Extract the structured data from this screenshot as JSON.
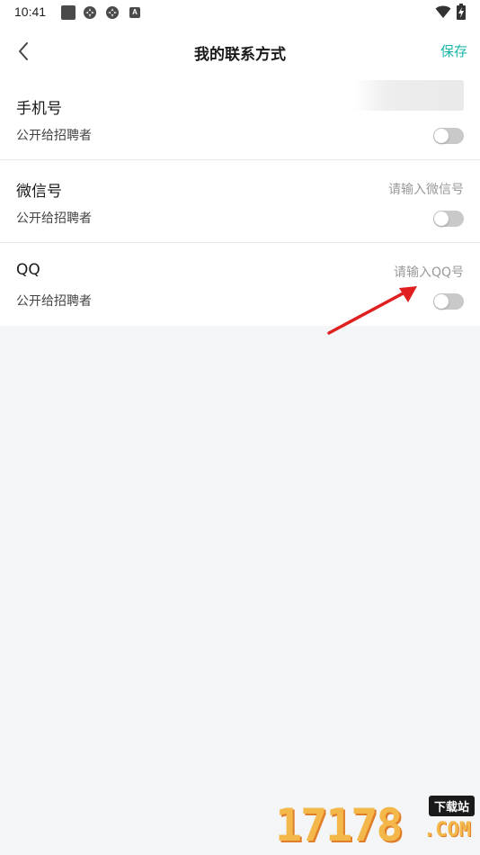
{
  "status_bar": {
    "time": "10:41",
    "icons": [
      "stop-square-icon",
      "gear-icon",
      "gear-icon",
      "a-badge-icon",
      "wifi-icon",
      "battery-charging-icon"
    ],
    "a_badge": "A"
  },
  "header": {
    "back_icon": "chevron-left-icon",
    "title": "我的联系方式",
    "save_label": "保存",
    "accent_color": "#18b8a8"
  },
  "rows": [
    {
      "label": "手机号",
      "value": "",
      "placeholder": "",
      "public_label": "公开给招聘者",
      "public": false
    },
    {
      "label": "微信号",
      "value": "",
      "placeholder": "请输入微信号",
      "public_label": "公开给招聘者",
      "public": false
    },
    {
      "label": "QQ",
      "value": "",
      "placeholder": "请输入QQ号",
      "public_label": "公开给招聘者",
      "public": false
    }
  ],
  "annotation": {
    "arrow_color": "#e02020"
  },
  "watermark": {
    "number": "17178",
    "tag": "下载站",
    "domain": ".COM"
  }
}
